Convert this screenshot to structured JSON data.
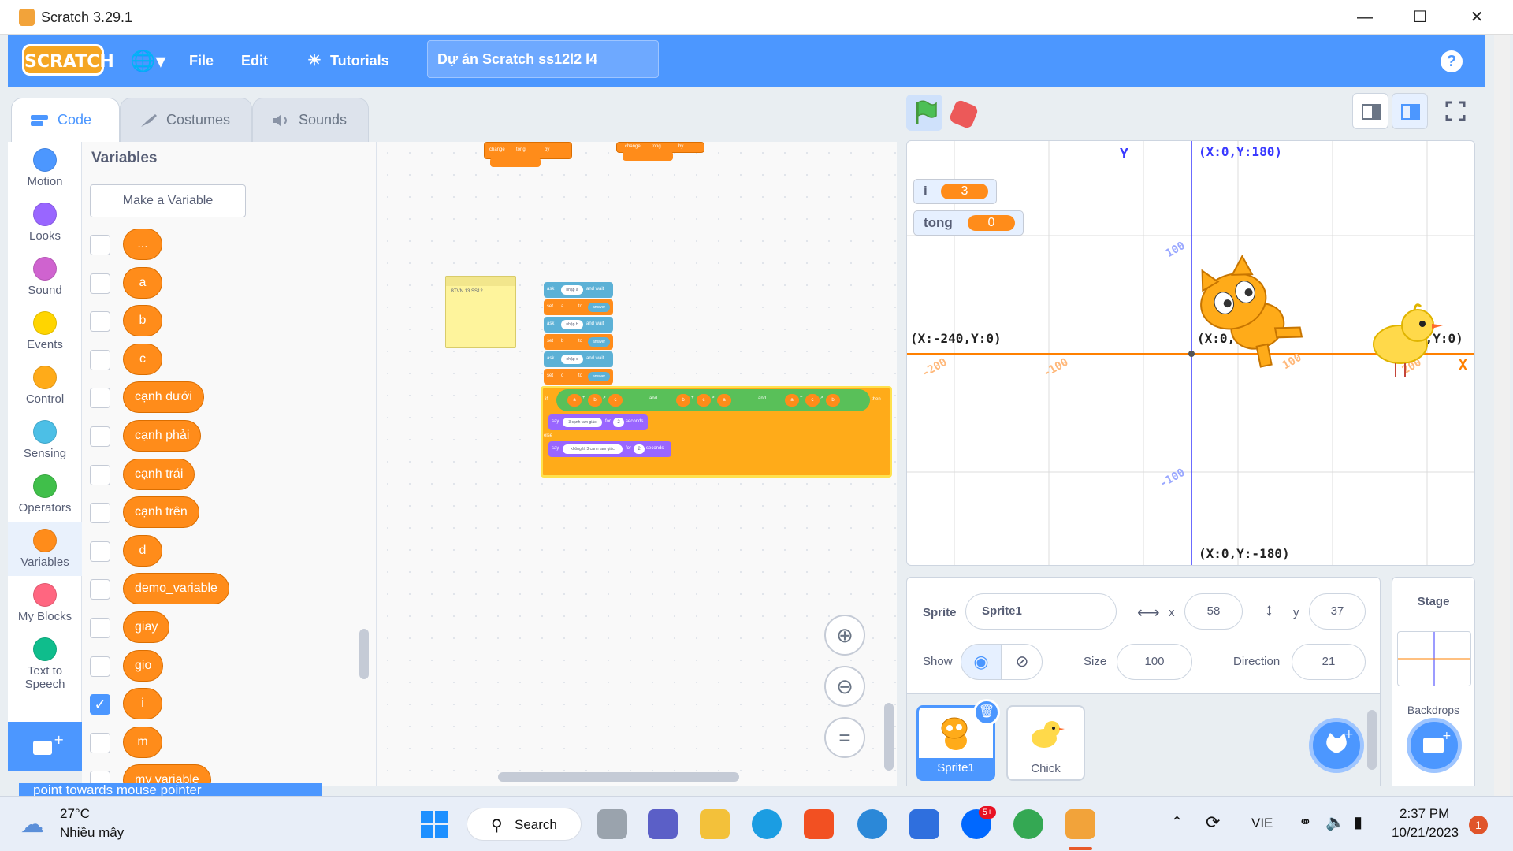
{
  "window": {
    "title": "Scratch 3.29.1"
  },
  "menubar": {
    "logo": "SCRATCH",
    "file": "File",
    "edit": "Edit",
    "tutorials": "Tutorials",
    "project_title": "Dự án Scratch ss12l2 l4",
    "help": "?"
  },
  "tabs": {
    "code": "Code",
    "costumes": "Costumes",
    "sounds": "Sounds"
  },
  "categories": [
    {
      "label": "Motion",
      "color": "#4c97ff"
    },
    {
      "label": "Looks",
      "color": "#9966ff"
    },
    {
      "label": "Sound",
      "color": "#cf63cf"
    },
    {
      "label": "Events",
      "color": "#ffd500"
    },
    {
      "label": "Control",
      "color": "#ffab19"
    },
    {
      "label": "Sensing",
      "color": "#4cbfe6"
    },
    {
      "label": "Operators",
      "color": "#40bf4a"
    },
    {
      "label": "Variables",
      "color": "#ff8c1a"
    },
    {
      "label": "My Blocks",
      "color": "#ff6680"
    },
    {
      "label": "Text to Speech",
      "color": "#0fbd8c"
    }
  ],
  "palette": {
    "header": "Variables",
    "make_variable": "Make a Variable",
    "variables": [
      {
        "name": "...",
        "checked": false
      },
      {
        "name": "a",
        "checked": false
      },
      {
        "name": "b",
        "checked": false
      },
      {
        "name": "c",
        "checked": false
      },
      {
        "name": "cạnh dưới",
        "checked": false
      },
      {
        "name": "cạnh phải",
        "checked": false
      },
      {
        "name": "cạnh trái",
        "checked": false
      },
      {
        "name": "cạnh trên",
        "checked": false
      },
      {
        "name": "d",
        "checked": false
      },
      {
        "name": "demo_variable",
        "checked": false
      },
      {
        "name": "giay",
        "checked": false
      },
      {
        "name": "gio",
        "checked": false
      },
      {
        "name": "i",
        "checked": true
      },
      {
        "name": "m",
        "checked": false
      },
      {
        "name": "my variable",
        "checked": false
      }
    ],
    "hidden_block_text": "point towards   mouse pointer"
  },
  "code": {
    "note_text": "BTVN 13 SS12",
    "change_block": {
      "change": "change",
      "var": "tong",
      "by": "by"
    },
    "script": {
      "ask1": {
        "ask": "ask",
        "prompt": "nhập a",
        "wait": "and wait"
      },
      "set1": {
        "set": "set",
        "var": "a",
        "to": "to",
        "val": "answer"
      },
      "ask2": {
        "ask": "ask",
        "prompt": "nhập b",
        "wait": "and wait"
      },
      "set2": {
        "set": "set",
        "var": "b",
        "to": "to",
        "val": "answer"
      },
      "ask3": {
        "ask": "ask",
        "prompt": "nhập c",
        "wait": "and wait"
      },
      "set3": {
        "set": "set",
        "var": "c",
        "to": "to",
        "val": "answer"
      },
      "if_label": "if",
      "then_label": "then",
      "and_label": "and",
      "cond_vars": [
        "a",
        "b",
        "c",
        "b",
        "c",
        "a",
        "a",
        "c",
        "b"
      ],
      "plus": "+",
      "gt": ">",
      "say1": {
        "say": "say",
        "text": "3 cạnh tam giác",
        "for": "for",
        "secs": "2",
        "unit": "seconds"
      },
      "else_label": "else",
      "say2": {
        "say": "say",
        "text": "không là 3 cạnh tam giác",
        "for": "for",
        "secs": "2",
        "unit": "seconds"
      }
    }
  },
  "stage": {
    "monitors": [
      {
        "name": "i",
        "value": "3"
      },
      {
        "name": "tong",
        "value": "0"
      }
    ],
    "axis_y": "Y",
    "axis_x": "X",
    "coords": {
      "top": "(X:0,Y:180)",
      "left": "(X:-240,Y:0)",
      "center": "(X:0,Y:0)",
      "right": "0,Y:0)",
      "bottom": "(X:0,Y:-180)"
    },
    "ticks": {
      "y_pos": "100",
      "y_neg": "-100",
      "x_neg200": "-200",
      "x_neg100": "-100",
      "x_pos100": "100",
      "x_pos200": "200"
    }
  },
  "sprite_info": {
    "sprite_label": "Sprite",
    "sprite_name": "Sprite1",
    "x_label": "x",
    "x": "58",
    "y_label": "y",
    "y": "37",
    "show_label": "Show",
    "size_label": "Size",
    "size": "100",
    "direction_label": "Direction",
    "direction": "21"
  },
  "sprites": [
    {
      "name": "Sprite1",
      "selected": true
    },
    {
      "name": "Chick",
      "selected": false
    }
  ],
  "stage_pane": {
    "title": "Stage",
    "backdrops": "Backdrops"
  },
  "taskbar": {
    "weather_temp": "27°C",
    "weather_desc": "Nhiều mây",
    "search": "Search",
    "lang": "VIE",
    "time": "2:37 PM",
    "date": "10/21/2023",
    "notif_count": "1",
    "zalo_badge": "5+"
  }
}
